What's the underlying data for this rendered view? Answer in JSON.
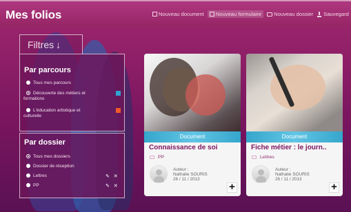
{
  "app": {
    "title": "Mes folios"
  },
  "toolbar": {
    "items": [
      {
        "label": "Nouveau document"
      },
      {
        "label": "Nouveau formulaire"
      },
      {
        "label": "Nouveau dossier"
      },
      {
        "label": "Sauvegard"
      }
    ]
  },
  "filters": {
    "title": "Filtres",
    "arrow": "↓",
    "parcours": {
      "heading": "Par parcours",
      "options": [
        {
          "label": "Tous mes parcours"
        },
        {
          "label": "Découverte des métiers et",
          "label_cont": "formations",
          "swatch": "#31a3cf"
        },
        {
          "label": "L'éducation artistique et",
          "label_cont": "culturelle",
          "swatch": "#f05a28"
        }
      ]
    },
    "dossier": {
      "heading": "Par dossier",
      "options": [
        {
          "label": "Tous mes dossiers"
        },
        {
          "label": "Dossier de réception"
        },
        {
          "label": "Lettres",
          "actions": "✎ ✕"
        },
        {
          "label": "PP",
          "actions": "✎ ✕"
        }
      ]
    }
  },
  "cards": [
    {
      "type": "Document",
      "title": "Connaissance de soi",
      "folder": "PP",
      "author_label": "Auteur :",
      "author": "Nathalie SOURIS",
      "date": "26 / 11 / 2013",
      "plus": "+"
    },
    {
      "type": "Document",
      "title": "Fiche métier : le journ..",
      "folder": "Lettres",
      "author_label": "Auteur :",
      "author": "Nathalie SOURIS",
      "date": "26 / 11 / 2013",
      "plus": "+"
    }
  ]
}
